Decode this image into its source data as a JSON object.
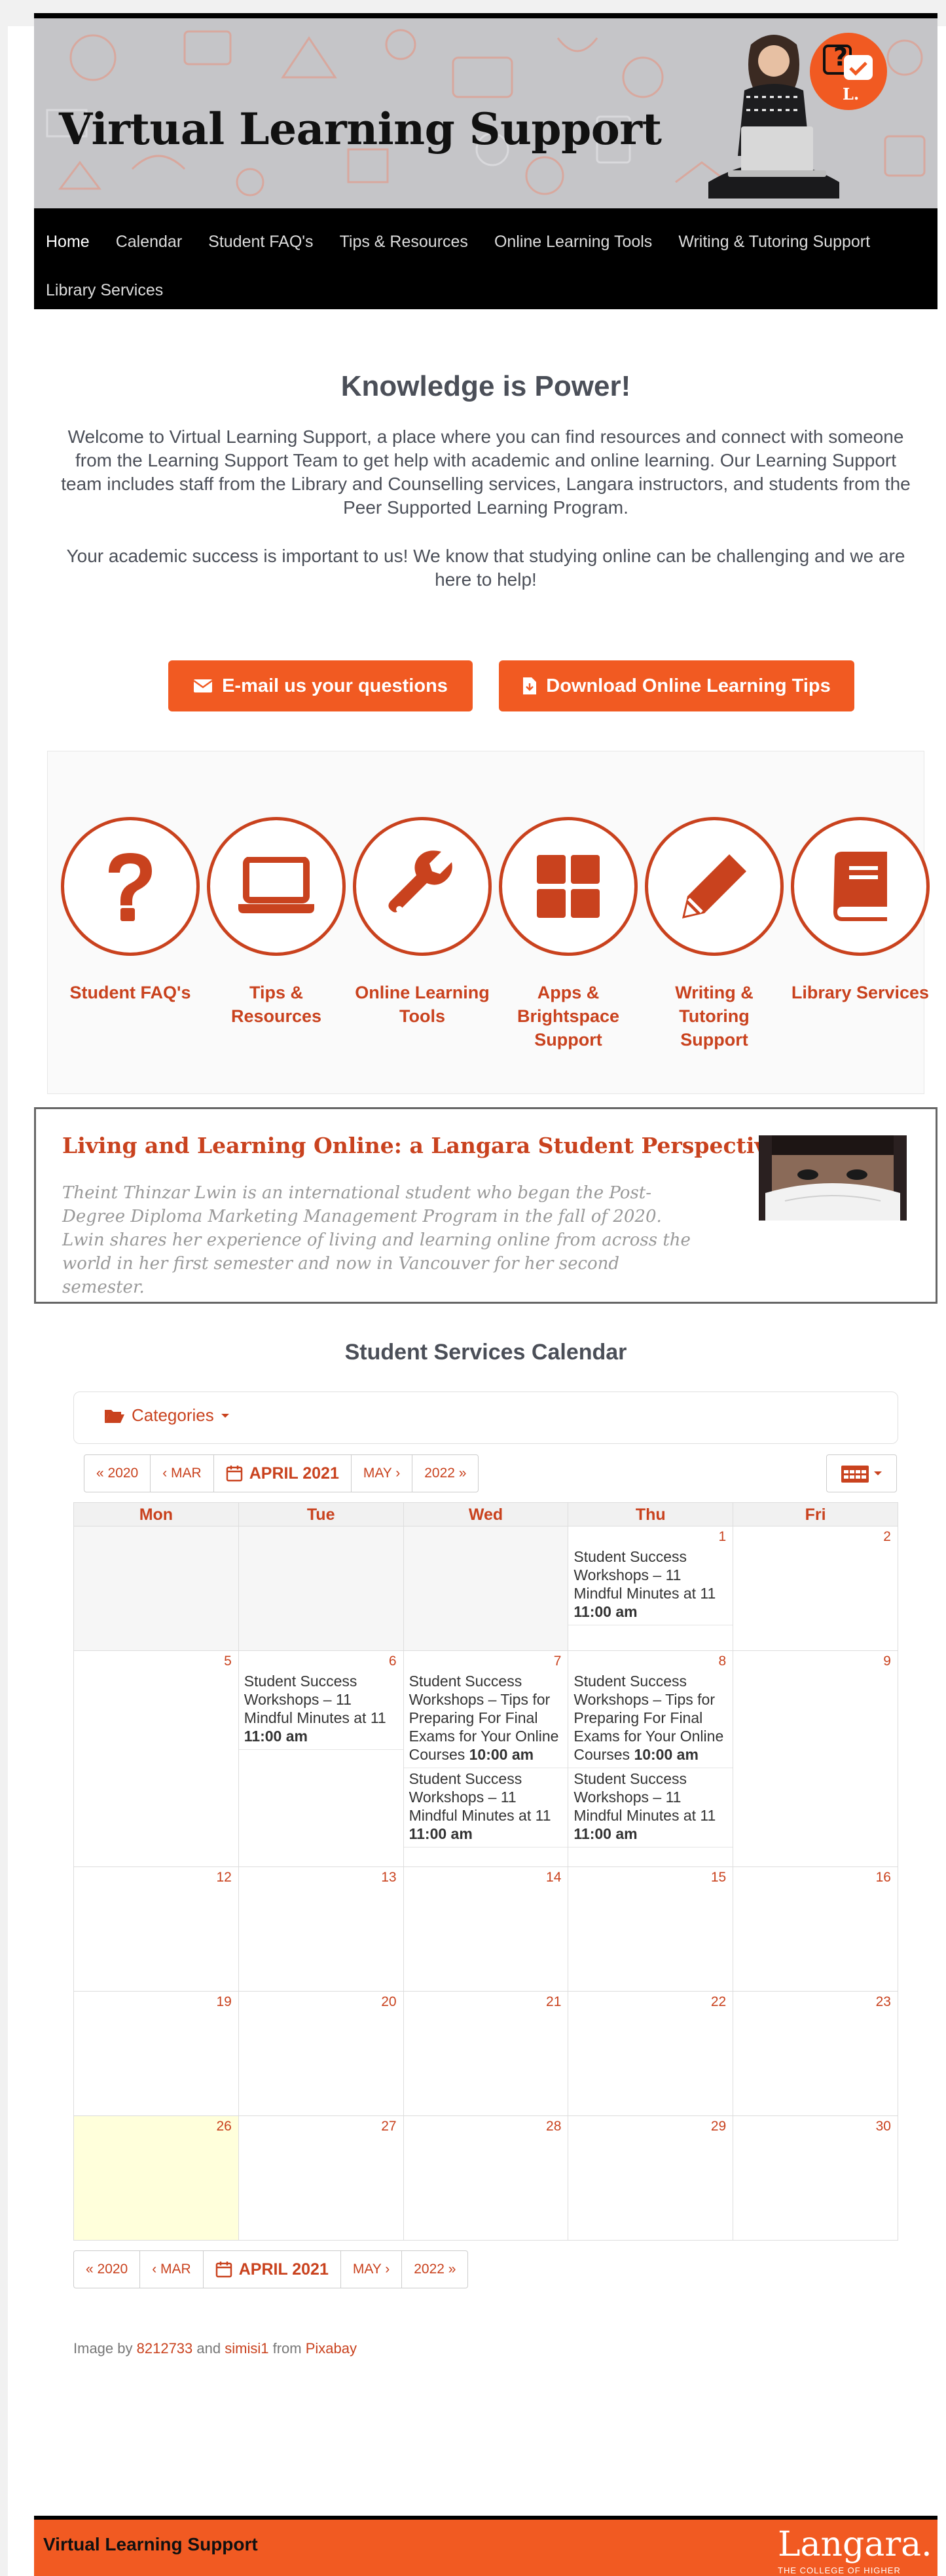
{
  "header": {
    "site_title": "Virtual Learning Support",
    "logo_letter": "L."
  },
  "nav": {
    "items": [
      {
        "label": "Home"
      },
      {
        "label": "Calendar"
      },
      {
        "label": "Student FAQ's"
      },
      {
        "label": "Tips & Resources"
      },
      {
        "label": "Online Learning Tools"
      },
      {
        "label": "Writing & Tutoring Support"
      },
      {
        "label": "Library Services"
      }
    ]
  },
  "intro": {
    "heading": "Knowledge is Power!",
    "p1": "Welcome to Virtual Learning Support, a place where you can find resources and connect with someone from the Learning Support Team to get help with academic and online learning. Our Learning Support team includes staff from the Library and Counselling services, Langara instructors, and students from the Peer Supported Learning Program.",
    "p2": "Your academic success is important to us! We know that studying online can be challenging and we are here to help!"
  },
  "cta": {
    "email_label": "E-mail us your questions",
    "download_label": "Download Online Learning Tips"
  },
  "services": [
    {
      "label": "Student FAQ's",
      "icon": "question-icon"
    },
    {
      "label": "Tips & Resources",
      "icon": "laptop-icon"
    },
    {
      "label": "Online Learning Tools",
      "icon": "wrench-icon"
    },
    {
      "label": "Apps & Brightspace Support",
      "icon": "grid-icon"
    },
    {
      "label": "Writing & Tutoring Support",
      "icon": "pencil-icon"
    },
    {
      "label": "Library Services",
      "icon": "book-icon"
    }
  ],
  "feature": {
    "title": "Living and Learning Online: a Langara Student Perspective",
    "text": "Theint Thinzar Lwin is an international student who began the Post-Degree Diploma Marketing Management Program in the fall of 2020. Lwin shares her experience of living and learning online from across the world in her first semester and now in Vancouver for her second semester."
  },
  "calendar": {
    "title": "Student Services Calendar",
    "categories_label": "Categories",
    "nav": {
      "prev_year": "« 2020",
      "prev_month": "‹ MAR",
      "current": "APRIL 2021",
      "next_month": "MAY ›",
      "next_year": "2022 »"
    },
    "weekdays": [
      "Mon",
      "Tue",
      "Wed",
      "Thu",
      "Fri"
    ],
    "weeks": [
      [
        {
          "day": "",
          "empty": true,
          "events": []
        },
        {
          "day": "",
          "empty": true,
          "events": []
        },
        {
          "day": "",
          "empty": true,
          "events": []
        },
        {
          "day": "1",
          "events": [
            {
              "title": "Student Success Workshops – 11 Mindful Minutes at 11",
              "time": "11:00 am"
            }
          ]
        },
        {
          "day": "2",
          "events": []
        }
      ],
      [
        {
          "day": "5",
          "events": []
        },
        {
          "day": "6",
          "events": [
            {
              "title": "Student Success Workshops – 11 Mindful Minutes at 11",
              "time": "11:00 am"
            }
          ]
        },
        {
          "day": "7",
          "events": [
            {
              "title": "Student Success Workshops – Tips for Preparing For Final Exams for Your Online Courses",
              "time": "10:00 am"
            },
            {
              "title": "Student Success Workshops – 11 Mindful Minutes at 11",
              "time": "11:00 am"
            }
          ]
        },
        {
          "day": "8",
          "events": [
            {
              "title": "Student Success Workshops – Tips for Preparing For Final Exams for Your Online Courses",
              "time": "10:00 am"
            },
            {
              "title": "Student Success Workshops – 11 Mindful Minutes at 11",
              "time": "11:00 am"
            }
          ]
        },
        {
          "day": "9",
          "events": []
        }
      ],
      [
        {
          "day": "12",
          "events": []
        },
        {
          "day": "13",
          "events": []
        },
        {
          "day": "14",
          "events": []
        },
        {
          "day": "15",
          "events": []
        },
        {
          "day": "16",
          "events": []
        }
      ],
      [
        {
          "day": "19",
          "events": []
        },
        {
          "day": "20",
          "events": []
        },
        {
          "day": "21",
          "events": []
        },
        {
          "day": "22",
          "events": []
        },
        {
          "day": "23",
          "events": []
        }
      ],
      [
        {
          "day": "26",
          "today": true,
          "events": []
        },
        {
          "day": "27",
          "events": []
        },
        {
          "day": "28",
          "events": []
        },
        {
          "day": "29",
          "events": []
        },
        {
          "day": "30",
          "events": []
        }
      ]
    ]
  },
  "credit": {
    "prefix": "Image by",
    "author1": "8212733",
    "and": "and",
    "author2": "simisi1",
    "from": "from",
    "source": "Pixabay"
  },
  "footer": {
    "title": "Virtual Learning Support",
    "logo": "Langara.",
    "tagline": "THE COLLEGE OF HIGHER LEARNING"
  },
  "colors": {
    "accent": "#f15a22",
    "accent_dark": "#c9421e",
    "nav_bg": "#000000"
  }
}
